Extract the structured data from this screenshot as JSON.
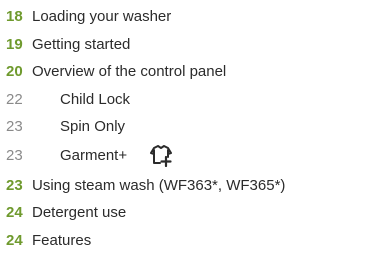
{
  "toc": {
    "entries": [
      {
        "page": "18",
        "title": "Loading your washer",
        "level": "main"
      },
      {
        "page": "19",
        "title": "Getting started",
        "level": "main"
      },
      {
        "page": "20",
        "title": "Overview of the control panel",
        "level": "main"
      },
      {
        "page": "22",
        "title": "Child Lock",
        "level": "sub"
      },
      {
        "page": "23",
        "title": "Spin Only",
        "level": "sub"
      },
      {
        "page": "23",
        "title": "Garment+",
        "level": "sub",
        "icon": "garment-plus-icon"
      },
      {
        "page": "23",
        "title": "Using steam wash (WF363*, WF365*)",
        "level": "main"
      },
      {
        "page": "24",
        "title": "Detergent use",
        "level": "main"
      },
      {
        "page": "24",
        "title": "Features",
        "level": "main"
      }
    ]
  },
  "colors": {
    "page_number_main": "#6f9a2e",
    "page_number_sub": "#8a8a8a",
    "text": "#2b2b2b"
  }
}
